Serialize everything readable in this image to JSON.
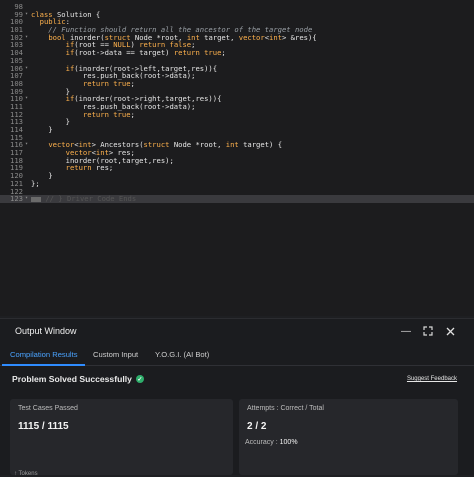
{
  "editor": {
    "lines": [
      {
        "n": "98",
        "code": ""
      },
      {
        "n": "99",
        "code": "class Solution {",
        "fold": true
      },
      {
        "n": "100",
        "code": "  public:"
      },
      {
        "n": "101",
        "code": "    // Function should return all the ancestor of the target node",
        "comment": true
      },
      {
        "n": "102",
        "code": "    bool inorder(struct Node *root, int target, vector<int> &res){",
        "fold": true
      },
      {
        "n": "103",
        "code": "        if(root == NULL) return false;"
      },
      {
        "n": "104",
        "code": "        if(root->data == target) return true;"
      },
      {
        "n": "105",
        "code": ""
      },
      {
        "n": "106",
        "code": "        if(inorder(root->left,target,res)){",
        "fold": true
      },
      {
        "n": "107",
        "code": "            res.push_back(root->data);"
      },
      {
        "n": "108",
        "code": "            return true;"
      },
      {
        "n": "109",
        "code": "        }"
      },
      {
        "n": "110",
        "code": "        if(inorder(root->right,target,res)){",
        "fold": true
      },
      {
        "n": "111",
        "code": "            res.push_back(root->data);"
      },
      {
        "n": "112",
        "code": "            return true;"
      },
      {
        "n": "113",
        "code": "        }"
      },
      {
        "n": "114",
        "code": "    }"
      },
      {
        "n": "115",
        "code": ""
      },
      {
        "n": "116",
        "code": "    vector<int> Ancestors(struct Node *root, int target) {",
        "fold": true
      },
      {
        "n": "117",
        "code": "        vector<int> res;"
      },
      {
        "n": "118",
        "code": "        inorder(root,target,res);"
      },
      {
        "n": "119",
        "code": "        return res;"
      },
      {
        "n": "120",
        "code": "    }"
      },
      {
        "n": "121",
        "code": "};"
      },
      {
        "n": "122",
        "code": ""
      },
      {
        "n": "123",
        "code": "// } Driver Code Ends",
        "active": true,
        "fold": true
      }
    ]
  },
  "output": {
    "title": "Output Window",
    "tabs": [
      {
        "label": "Compilation Results",
        "active": true
      },
      {
        "label": "Custom Input",
        "active": false
      },
      {
        "label": "Y.O.G.I. (AI Bot)",
        "active": false
      }
    ],
    "status": "Problem Solved Successfully",
    "feedback": "Suggest Feedback",
    "test_cases": {
      "label": "Test Cases Passed",
      "value": "1115 / 1115"
    },
    "attempts": {
      "label": "Attempts : Correct / Total",
      "value": "2 / 2",
      "accuracy_label": "Accuracy :",
      "accuracy_value": "100%"
    },
    "bottom_peek": "↑  Tokens"
  },
  "icons": {
    "minimize": "minimize-icon",
    "expand": "expand-icon",
    "close": "close-icon",
    "status": "check-circle-icon"
  },
  "colors": {
    "accent": "#2f8cff",
    "success": "#2eae6b",
    "keyword": "#ffb24d"
  }
}
